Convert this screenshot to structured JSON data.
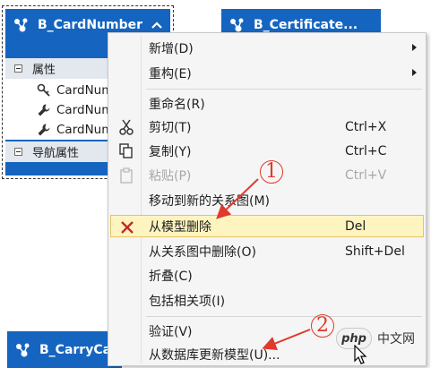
{
  "entities": {
    "card": {
      "title": "B_CardNumber",
      "sections": {
        "properties": "属性",
        "navigation": "导航属性"
      },
      "properties": [
        {
          "label": "CardNum",
          "icon": "key-icon"
        },
        {
          "label": "CardNum",
          "icon": "wrench-icon"
        },
        {
          "label": "CardNum",
          "icon": "wrench-icon"
        }
      ]
    },
    "certificate": {
      "title": "B_Certificate..."
    },
    "carry": {
      "title": "B_CarryCab"
    }
  },
  "context_menu": {
    "items": [
      {
        "label": "新增(D)",
        "submenu": true
      },
      {
        "label": "重构(E)",
        "submenu": true
      },
      {
        "label": "重命名(R)"
      },
      {
        "label": "剪切(T)",
        "shortcut": "Ctrl+X",
        "icon": "scissors-icon"
      },
      {
        "label": "复制(Y)",
        "shortcut": "Ctrl+C",
        "icon": "copy-icon"
      },
      {
        "label": "粘贴(P)",
        "shortcut": "Ctrl+V",
        "icon": "paste-icon",
        "disabled": true
      },
      {
        "label": "移动到新的关系图(M)"
      },
      {
        "label": "从模型删除",
        "shortcut": "Del",
        "icon": "delete-x-icon",
        "highlighted": true
      },
      {
        "label": "从关系图中删除(O)",
        "shortcut": "Shift+Del"
      },
      {
        "label": "折叠(C)"
      },
      {
        "label": "包括相关项(I)"
      },
      {
        "label": "验证(V)"
      },
      {
        "label": "从数据库更新模型(U)..."
      }
    ]
  },
  "annotations": {
    "marker_1": "1",
    "marker_2": "2"
  },
  "watermark": {
    "logo": "php",
    "text": "中文网"
  },
  "colors": {
    "entity_header": "#1565c0",
    "section_bg": "#e3e8ef",
    "menu_bg": "#f5f5f5",
    "highlight_bg": "#fdf4bf",
    "annotation_red": "#e03a2c"
  }
}
